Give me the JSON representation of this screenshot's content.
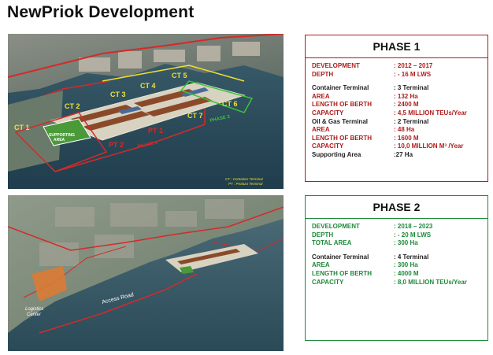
{
  "title": "NewPriok Development",
  "top_map": {
    "labels": {
      "ct1": "CT 1",
      "ct2": "CT 2",
      "ct3": "CT 3",
      "ct4": "CT 4",
      "ct5": "CT 5",
      "ct6": "CT 6",
      "ct7": "CT 7",
      "pt1": "PT 1",
      "pt2": "PT 2",
      "phase1": "PHASE 1",
      "phase2": "PHASE 2",
      "supporting_area_line1": "SUPPORTING",
      "supporting_area_line2": "AREA"
    },
    "legend": {
      "ct": "CT : Container Terminal",
      "pt": "PT : Product Terminal"
    }
  },
  "bottom_map": {
    "labels": {
      "access_road": "Access Road",
      "logistics_line1": "Logistics",
      "logistics_line2": "Center"
    }
  },
  "phase1": {
    "heading": "PHASE 1",
    "border_color": "#b01c1c",
    "rows": [
      {
        "label": "DEVELOPMENT",
        "value": ": 2012 – 2017",
        "tone": "red"
      },
      {
        "label": "DEPTH",
        "value": ": - 16 M LWS",
        "tone": "red"
      },
      {
        "label": "Container Terminal",
        "value": ": 3 Terminal",
        "tone": "dark"
      },
      {
        "label": "AREA",
        "value": ": 132 Ha",
        "tone": "red"
      },
      {
        "label": "LENGTH OF BERTH",
        "value": ": 2400 M",
        "tone": "red"
      },
      {
        "label": "CAPACITY",
        "value": ": 4,5 MILLION TEUs/Year",
        "tone": "red"
      },
      {
        "label": "Oil & Gas Terminal",
        "value": ": 2 Terminal",
        "tone": "dark"
      },
      {
        "label": "AREA",
        "value": ": 48 Ha",
        "tone": "red"
      },
      {
        "label": "LENGTH OF BERTH",
        "value": ": 1600 M",
        "tone": "red"
      },
      {
        "label": "CAPACITY",
        "value": ": 10,0 MILLION M³ /Year",
        "tone": "red"
      },
      {
        "label": "Supporting Area",
        "value": ":27 Ha",
        "tone": "dark"
      }
    ]
  },
  "phase2": {
    "heading": "PHASE 2",
    "border_color": "#1e8a3a",
    "rows": [
      {
        "label": "DEVELOPMENT",
        "value": ": 2018 – 2023",
        "tone": "green"
      },
      {
        "label": "DEPTH",
        "value": ": - 20 M LWS",
        "tone": "green"
      },
      {
        "label": "TOTAL AREA",
        "value": ": 300 Ha",
        "tone": "green"
      },
      {
        "label": "Container Terminal",
        "value": ": 4 Terminal",
        "tone": "dark"
      },
      {
        "label": "AREA",
        "value": ": 300 Ha",
        "tone": "green"
      },
      {
        "label": "LENGTH OF BERTH",
        "value": ": 4000 M",
        "tone": "green"
      },
      {
        "label": "CAPACITY",
        "value": ": 8,0 MILLION TEUs/Year",
        "tone": "green"
      }
    ]
  }
}
